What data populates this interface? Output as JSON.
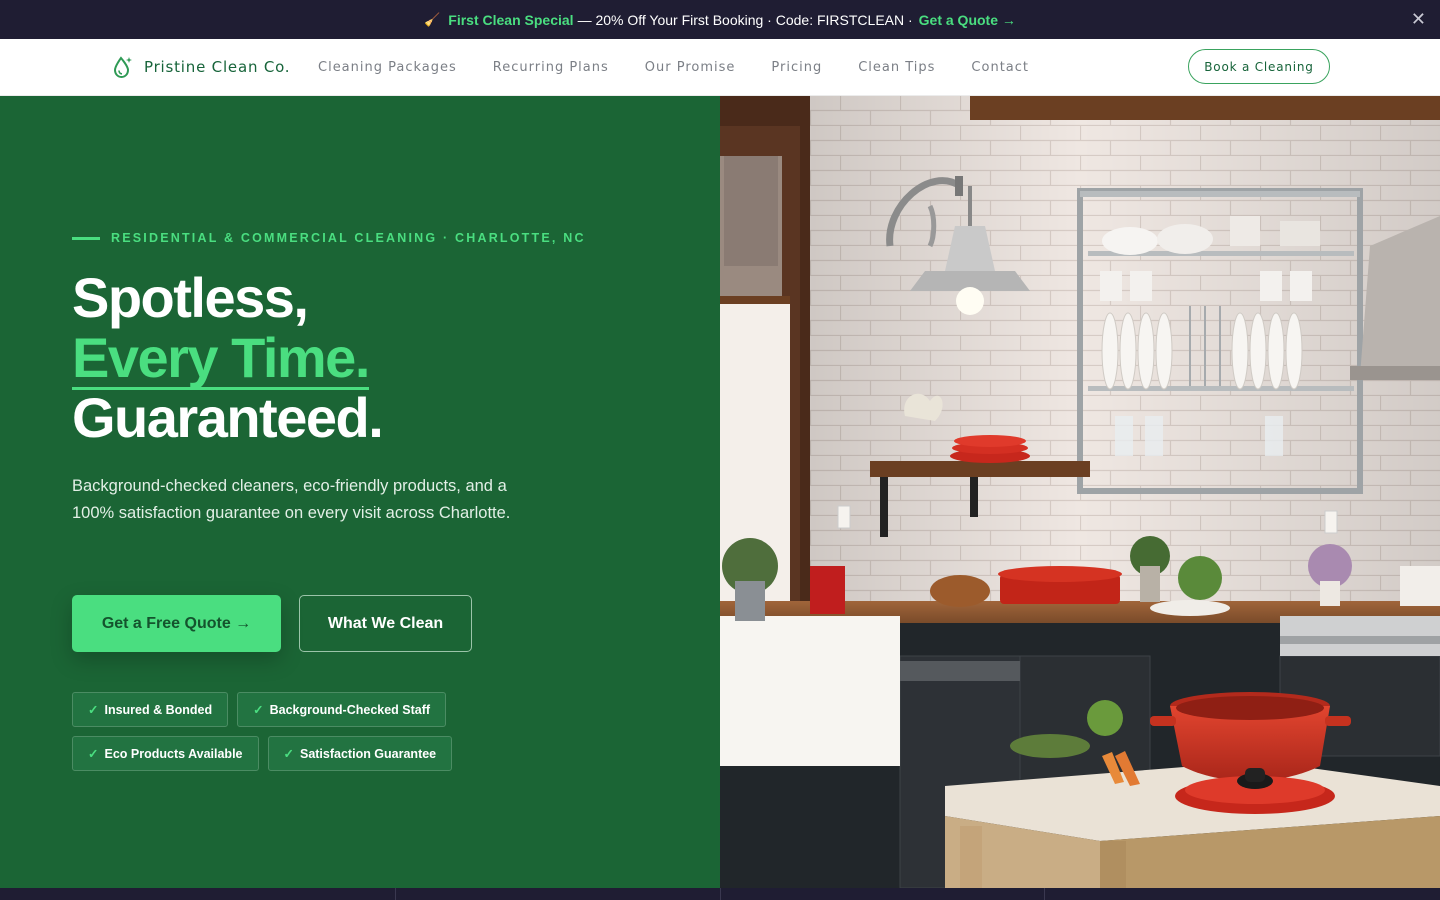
{
  "announcement": {
    "icon": "broom-icon",
    "special": "First Clean Special",
    "text": "— 20% Off Your First Booking · Code: FIRSTCLEAN ·",
    "link": "Get a Quote →",
    "close": "✕"
  },
  "nav": {
    "logo_text": "Pristine Clean Co.",
    "links": [
      "Cleaning Packages",
      "Recurring Plans",
      "Our Promise",
      "Pricing",
      "Clean Tips",
      "Contact"
    ],
    "cta": "Book a Cleaning"
  },
  "hero": {
    "eyebrow": "RESIDENTIAL & COMMERCIAL CLEANING · CHARLOTTE, NC",
    "headline": [
      "Spotless,",
      "Every Time.",
      "Guaranteed."
    ],
    "subtext": "Background-checked cleaners, eco-friendly products, and a 100% satisfaction guarantee on every visit across Charlotte.",
    "primary_cta": "Get a Free Quote →",
    "secondary_cta": "What We Clean",
    "badges": [
      "Insured & Bonded",
      "Background-Checked Staff",
      "Eco Products Available",
      "Satisfaction Guarantee"
    ],
    "check": "✓"
  },
  "colors": {
    "accent": "#4ade80",
    "hero_green": "#1b6535",
    "dark_bar": "#1f1d33",
    "brand_text": "#17643a"
  }
}
